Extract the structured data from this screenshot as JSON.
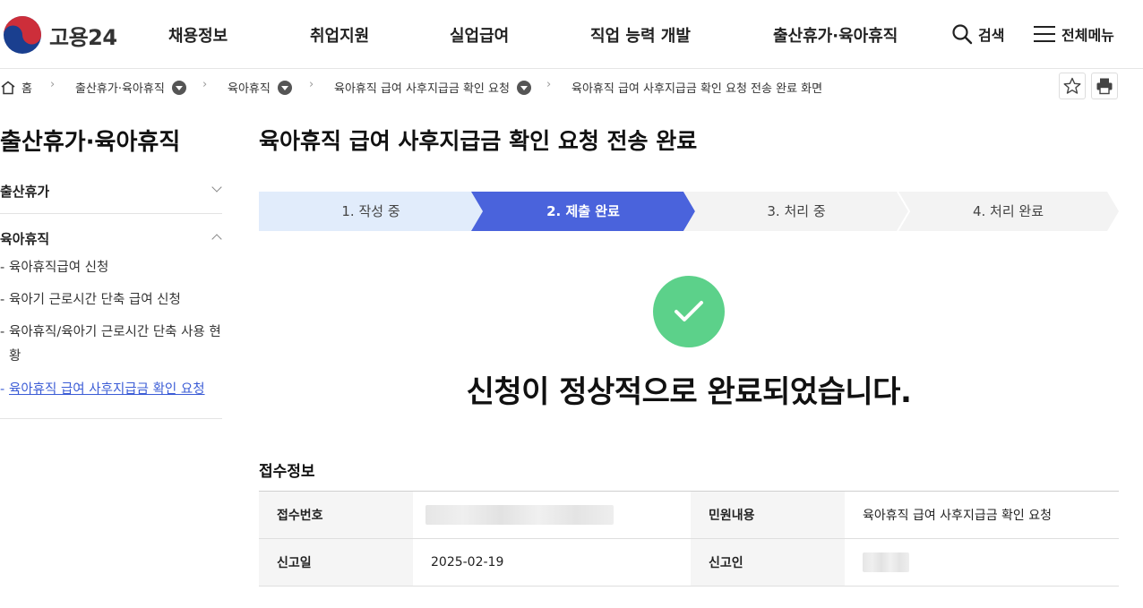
{
  "header": {
    "logo_text": "고용24",
    "nav": [
      "채용정보",
      "취업지원",
      "실업급여",
      "직업 능력 개발",
      "출산휴가·육아휴직"
    ],
    "search_label": "검색",
    "menu_label": "전체메뉴"
  },
  "breadcrumb": {
    "home": "홈",
    "items": [
      "출산휴가·육아휴직",
      "육아휴직",
      "육아휴직 급여 사후지급금 확인 요청",
      "육아휴직 급여 사후지급금 확인 요청 전송 완료 화면"
    ]
  },
  "sidebar": {
    "title": "출산휴가·육아휴직",
    "groups": [
      {
        "label": "출산휴가",
        "expanded": false
      },
      {
        "label": "육아휴직",
        "expanded": true
      }
    ],
    "sub_items": [
      {
        "label": "육아휴직급여 신청"
      },
      {
        "label": "육아기 근로시간 단축 급여 신청"
      },
      {
        "label": "육아휴직/육아기 근로시간 단축 사용 현황"
      },
      {
        "label": "육아휴직 급여 사후지급금 확인 요청",
        "active": true
      }
    ]
  },
  "main": {
    "title": "육아휴직 급여 사후지급금 확인 요청 전송 완료",
    "steps": [
      {
        "label": "1. 작성 중",
        "state": "done"
      },
      {
        "label": "2. 제출 완료",
        "state": "current"
      },
      {
        "label": "3. 처리 중",
        "state": "todo"
      },
      {
        "label": "4. 처리 완료",
        "state": "todo"
      }
    ],
    "complete_message": "신청이 정상적으로 완료되었습니다.",
    "section_title": "접수정보",
    "table": [
      {
        "label1": "접수번호",
        "value1": "",
        "label2": "민원내용",
        "value2": "육아휴직 급여 사후지급금 확인 요청"
      },
      {
        "label1": "신고일",
        "value1": "2025-02-19",
        "label2": "신고인",
        "value2": ""
      }
    ]
  },
  "colors": {
    "step_done": "#e1ecfb",
    "step_current": "#4a63dc",
    "step_todo": "#f3f3f3",
    "success": "#5cd18a",
    "link_active": "#3b5cd6"
  },
  "icons": {
    "search": "search-icon",
    "menu": "hamburger-icon",
    "home": "home-icon",
    "star": "star-icon",
    "print": "print-icon",
    "check": "check-icon"
  }
}
